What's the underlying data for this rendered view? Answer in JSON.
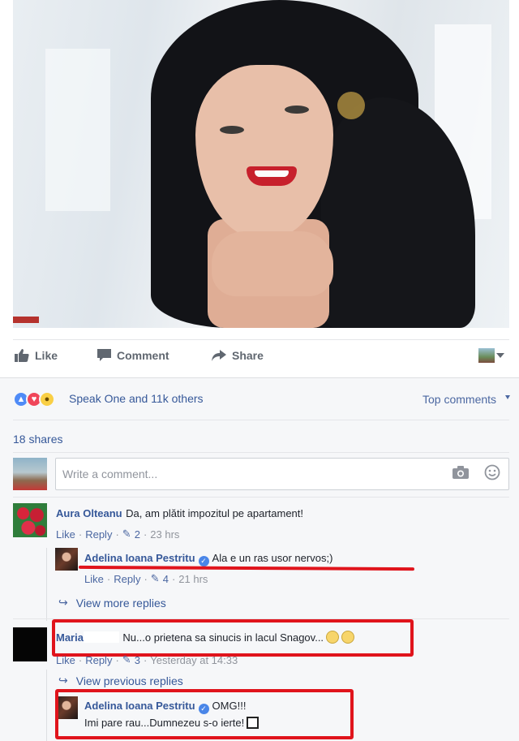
{
  "photo": {
    "watermark": ""
  },
  "actions": {
    "like_label": "Like",
    "comment_label": "Comment",
    "share_label": "Share"
  },
  "reactions": {
    "types": [
      "like-icon",
      "love-icon",
      "wow-icon"
    ],
    "summary": "Speak One and 11k others"
  },
  "sort": {
    "label": "Top comments"
  },
  "shares": {
    "label": "18 shares"
  },
  "composer": {
    "placeholder": "Write a comment..."
  },
  "comments": [
    {
      "author": "Aura Olteanu",
      "text": "Da, am plătit impozitul pe apartament!",
      "like": "Like",
      "reply": "Reply",
      "likes": "2",
      "time": "23 hrs",
      "replies": [
        {
          "author": "Adelina Ioana Pestritu",
          "text": "Ala e un ras usor nervos;)",
          "like": "Like",
          "reply": "Reply",
          "likes": "4",
          "time": "21 hrs"
        }
      ],
      "more_replies": "View more replies"
    },
    {
      "author": "Maria",
      "text": "Nu...o prietena sa sinucis in lacul Snagov...",
      "like": "Like",
      "reply": "Reply",
      "likes": "3",
      "time": "Yesterday at 14:33",
      "previous_replies": "View previous replies",
      "replies": [
        {
          "author": "Adelina Ioana Pestritu",
          "text_line1": "OMG!!!",
          "text_line2": "Imi pare rau...Dumnezeu s-o ierte!"
        }
      ]
    }
  ],
  "colors": {
    "link": "#365899",
    "annotation_red": "#e0141c",
    "panel_bg": "#f6f7f9"
  }
}
